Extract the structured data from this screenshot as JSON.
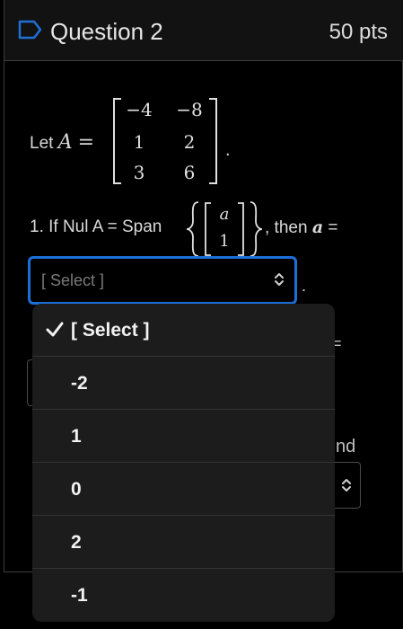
{
  "header": {
    "title": "Question 2",
    "points": "50 pts"
  },
  "prompt": {
    "let_label": "Let",
    "matrix_name": "A",
    "equals": "=",
    "matrix": [
      [
        "−4",
        "−8"
      ],
      [
        "1",
        "2"
      ],
      [
        "3",
        "6"
      ]
    ],
    "end_period": "."
  },
  "question1": {
    "text": "1. If Nul A = Span",
    "vector": [
      "a",
      "1"
    ],
    "tail_prefix": ", then",
    "tail_var": "a",
    "tail_suffix": "="
  },
  "select1": {
    "placeholder": "[ Select ]",
    "after": "."
  },
  "background_fragments": {
    "fragment1": "=",
    "fragment2": "nd"
  },
  "dropdown": {
    "options": [
      "[ Select ]",
      "-2",
      "1",
      "0",
      "2",
      "-1"
    ],
    "selected_index": 0
  },
  "colors": {
    "accent": "#1c6fd8",
    "background": "#000000",
    "dropdown_bg": "#1c1c1c"
  }
}
